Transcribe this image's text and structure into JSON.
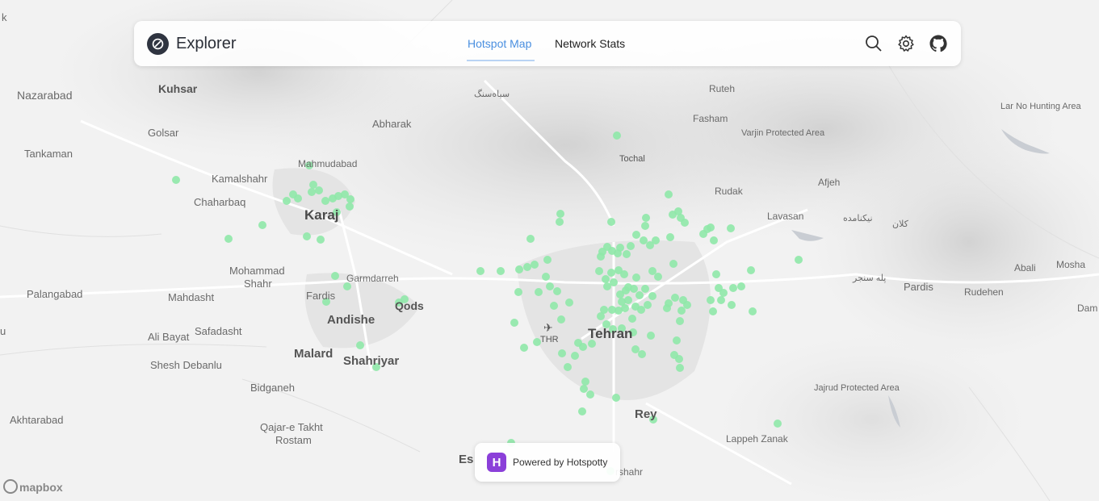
{
  "app": {
    "brand": "Explorer"
  },
  "nav": {
    "tabs": [
      {
        "label": "Hotspot Map",
        "active": true
      },
      {
        "label": "Network Stats",
        "active": false
      }
    ]
  },
  "toolbar": {
    "icons": [
      "search-icon",
      "gear-icon",
      "github-icon"
    ]
  },
  "footer": {
    "powered_by": "Powered by Hotspotty",
    "powered_logo_letter": "H",
    "attribution": "mapbox"
  },
  "colors": {
    "hotspot": "#8fe8a8",
    "active_tab": "#4a8fe0",
    "powered_logo": "#8b3fd9",
    "map_background": "#f2f2f2"
  },
  "map": {
    "labels": {
      "nazarabad": "Nazarabad",
      "kuhsar": "Kuhsar",
      "golsar": "Golsar",
      "tankaman": "Tankaman",
      "kamalshahr": "Kamalshahr",
      "mahmudabad": "Mahmudabad",
      "chaharbaq": "Chaharbaq",
      "karaj": "Karaj",
      "mohammad_shahr_1": "Mohammad",
      "mohammad_shahr_2": "Shahr",
      "palangabad": "Palangabad",
      "mahdasht": "Mahdasht",
      "fardis": "Fardis",
      "garmdarreh": "Garmdarreh",
      "qods": "Qods",
      "andishe": "Andishe",
      "safadasht": "Safadasht",
      "ali_bayat": "Ali Bayat",
      "malard": "Malard",
      "shahriyar": "Shahriyar",
      "shesh_debanlu": "Shesh Debanlu",
      "bidganeh": "Bidganeh",
      "akhtarabad": "Akhtarabad",
      "qajar_1": "Qajar-e Takht",
      "qajar_2": "Rostam",
      "abharak": "Abharak",
      "siahsang": "سیاه‌سنگ",
      "tochal": "Tochal",
      "ruteh": "Ruteh",
      "fasham": "Fasham",
      "varjin": "Varjin Protected Area",
      "lar": "Lar No Hunting Area",
      "afjeh": "Afjeh",
      "rudak": "Rudak",
      "lavasan": "Lavasan",
      "nikamadeh": "نیکنامده",
      "kolan": "کلان",
      "pele_sanjar": "پله سنجر",
      "pardis": "Pardis",
      "abali": "Abali",
      "mosha": "Mosha",
      "rudehen": "Rudehen",
      "dam": "Dam",
      "thr": "THR",
      "tehran": "Tehran",
      "jajrud": "Jajrud Protected Area",
      "rey": "Rey",
      "lappeh_zanak": "Lappeh Zanak",
      "es": "Es",
      "shahr_partial": "rshahr",
      "edge_k": "k",
      "edge_u1": "u",
      "edge_u2": "u"
    }
  }
}
